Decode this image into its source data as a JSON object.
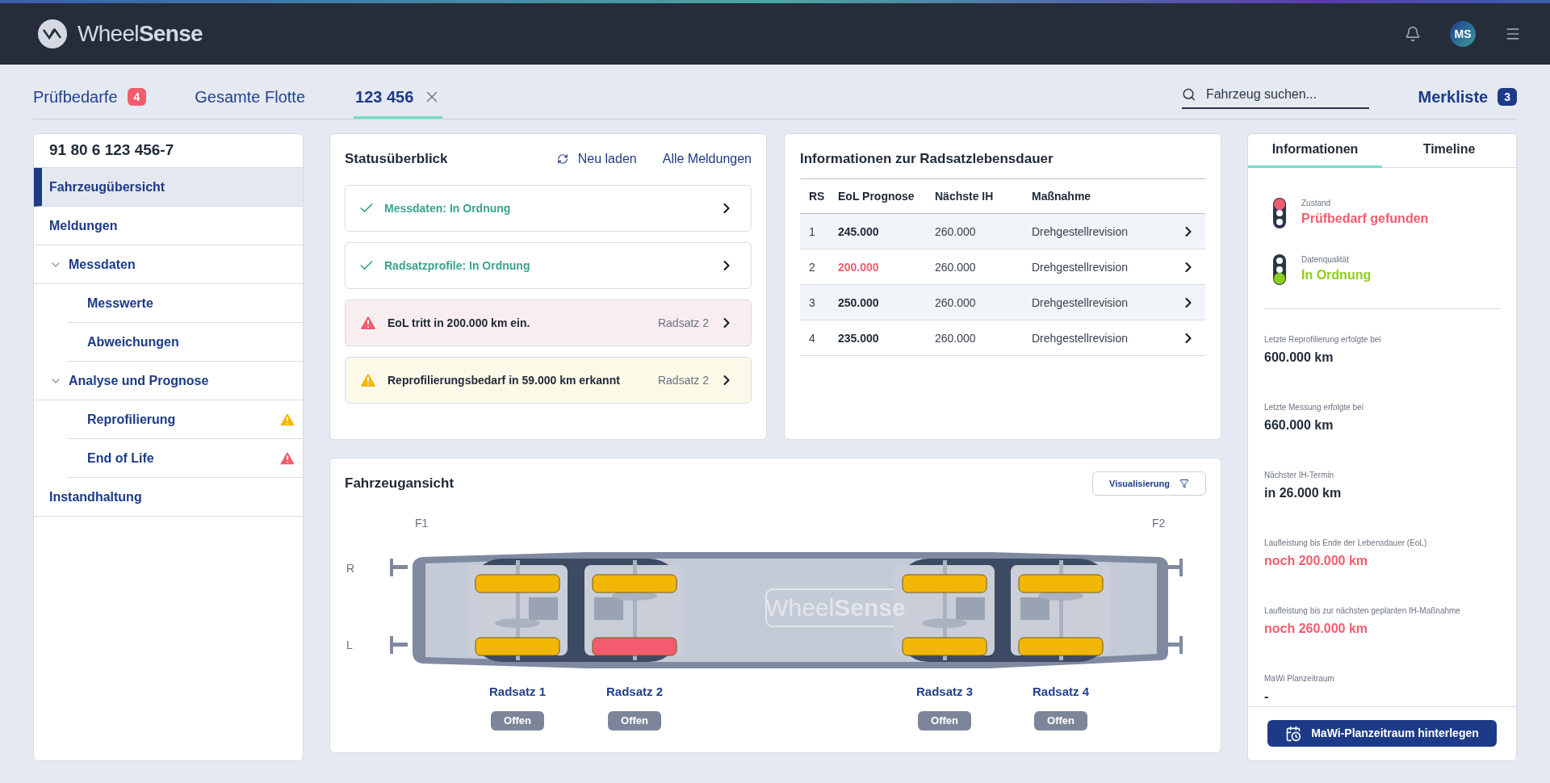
{
  "header": {
    "logo_light": "Wheel",
    "logo_bold": "Sense",
    "avatar": "MS"
  },
  "tabs": [
    {
      "label": "Prüfbedarfe",
      "badge": "4",
      "selected": false,
      "closable": false
    },
    {
      "label": "Gesamte Flotte",
      "selected": false,
      "closable": false
    },
    {
      "label": "123 456",
      "selected": true,
      "closable": true
    }
  ],
  "search": {
    "placeholder": "Fahrzeug suchen..."
  },
  "watchlist": {
    "label": "Merkliste",
    "count": "3"
  },
  "sidebar": {
    "title": "91 80 6 123 456-7",
    "items": [
      {
        "label": "Fahrzeugübersicht",
        "selected": true
      },
      {
        "label": "Meldungen",
        "selected": false
      },
      {
        "label": "Messdaten",
        "selected": false,
        "expanded": true,
        "children": [
          {
            "label": "Messwerte",
            "selected": false
          },
          {
            "label": "Abweichungen",
            "selected": false
          }
        ]
      },
      {
        "label": "Analyse und Prognose",
        "selected": false,
        "expanded": true,
        "children": [
          {
            "label": "Reprofilierung",
            "selected": false,
            "warning": true,
            "error": false
          },
          {
            "label": "End of Life",
            "selected": false,
            "warning": false,
            "error": true
          }
        ]
      },
      {
        "label": "Instandhaltung",
        "selected": false
      }
    ]
  },
  "status": {
    "title": "Statusüberblick",
    "reload": "Neu laden",
    "all": "Alle Meldungen",
    "messages": [
      {
        "kind": "ok",
        "text": "Messdaten: In Ordnung"
      },
      {
        "kind": "ok",
        "text": "Radsatzprofile: In Ordnung"
      },
      {
        "kind": "error",
        "text": "EoL tritt in 200.000 km ein.",
        "wheelset": "Radsatz 2"
      },
      {
        "kind": "warning",
        "text": "Reprofilierungsbedarf in 59.000 km erkannt",
        "wheelset": "Radsatz 2"
      }
    ]
  },
  "lifetime": {
    "title": "Informationen zur Radsatzlebensdauer",
    "columns": [
      "RS",
      "EoL Prognose",
      "Nächste IH",
      "Maßnahme"
    ],
    "rows": [
      {
        "rs": "1",
        "eol": "245.000",
        "critical": false,
        "next": "260.000",
        "action": "Drehgestellrevision"
      },
      {
        "rs": "2",
        "eol": "200.000",
        "critical": true,
        "next": "260.000",
        "action": "Drehgestellrevision"
      },
      {
        "rs": "3",
        "eol": "250.000",
        "critical": false,
        "next": "260.000",
        "action": "Drehgestellrevision"
      },
      {
        "rs": "4",
        "eol": "235.000",
        "critical": false,
        "next": "260.000",
        "action": "Drehgestellrevision"
      }
    ]
  },
  "vehicle": {
    "title": "Fahrzeugansicht",
    "filter": "Visualisierung",
    "end_left": "F1",
    "end_right": "F2",
    "side_top": "R",
    "side_bottom": "L",
    "body_logo_light": "Wheel",
    "body_logo_bold": "Sense",
    "wheelsets": [
      {
        "label": "Radsatz 1",
        "status": "Offen",
        "right_critical": false,
        "left_critical": false
      },
      {
        "label": "Radsatz 2",
        "status": "Offen",
        "right_critical": false,
        "left_critical": true
      },
      {
        "label": "Radsatz 3",
        "status": "Offen",
        "right_critical": false,
        "left_critical": false
      },
      {
        "label": "Radsatz 4",
        "status": "Offen",
        "right_critical": false,
        "left_critical": false
      }
    ]
  },
  "info_panel": {
    "tabs": [
      {
        "label": "Informationen",
        "selected": true
      },
      {
        "label": "Timeline",
        "selected": false
      }
    ],
    "status": [
      {
        "label": "Zustand",
        "value": "Prüfbedarf gefunden",
        "color": "#f25c6e"
      },
      {
        "label": "Datenqualität",
        "value": "In Ordnung",
        "color": "#8ccf1a"
      }
    ],
    "facts": [
      {
        "label": "Letzte Reprofilierung erfolgte bei",
        "value": "600.000 km",
        "critical": false
      },
      {
        "label": "Letzte Messung erfolgte bei",
        "value": "660.000 km",
        "critical": false
      },
      {
        "label": "Nächster IH-Termin",
        "value": "in 26.000 km",
        "critical": false
      },
      {
        "label": "Laufleistung bis Ende der Lebensdauer (EoL)",
        "value": "noch 200.000 km",
        "critical": true
      },
      {
        "label": "Laufleistung bis zur nächsten geplanten IH-Maßnahme",
        "value": "noch 260.000 km",
        "critical": true
      },
      {
        "label": "MaWi Planzeitraum",
        "value": "-",
        "critical": false
      }
    ],
    "button": "MaWi-Planzeitraum hinterlegen"
  }
}
